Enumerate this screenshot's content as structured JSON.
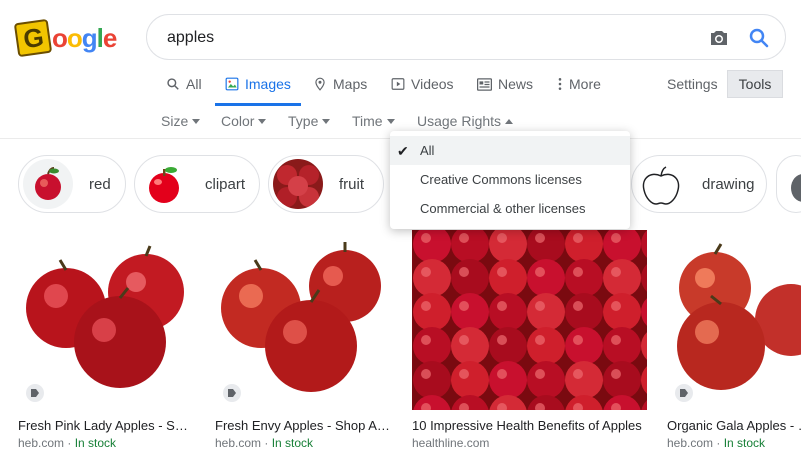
{
  "logo": {
    "text_parts": [
      "G",
      "o",
      "o",
      "g",
      "l",
      "e"
    ]
  },
  "search": {
    "query": "apples"
  },
  "nav": {
    "all": "All",
    "images": "Images",
    "maps": "Maps",
    "videos": "Videos",
    "news": "News",
    "more": "More",
    "settings": "Settings",
    "tools": "Tools"
  },
  "filters": {
    "size": "Size",
    "color": "Color",
    "type": "Type",
    "time": "Time",
    "usage_rights": "Usage Rights"
  },
  "chips": [
    {
      "label": "red"
    },
    {
      "label": "clipart"
    },
    {
      "label": "fruit"
    },
    {
      "label": "drawing"
    }
  ],
  "dropdown": {
    "items": [
      "All",
      "Creative Commons licenses",
      "Commercial & other licenses"
    ],
    "selected": "All"
  },
  "results": [
    {
      "title": "Fresh Pink Lady Apples - Sho…",
      "site": "heb.com",
      "sep": " · ",
      "status": "In stock"
    },
    {
      "title": "Fresh Envy Apples - Shop Ap…",
      "site": "heb.com",
      "sep": " · ",
      "status": "In stock"
    },
    {
      "title": "10 Impressive Health Benefits of Apples",
      "site": "healthline.com",
      "sep": "",
      "status": ""
    },
    {
      "title": "Organic Gala Apples - S…",
      "site": "heb.com",
      "sep": " · ",
      "status": "In stock"
    }
  ],
  "colors": {
    "accent": "#1a73e8",
    "stock": "#188038",
    "apple_red": "#c8102e"
  },
  "icons": [
    "camera-icon",
    "search-icon",
    "images-icon",
    "maps-pin-icon",
    "videos-icon",
    "news-icon",
    "more-dots-icon",
    "checkmark-icon",
    "tag-icon"
  ]
}
